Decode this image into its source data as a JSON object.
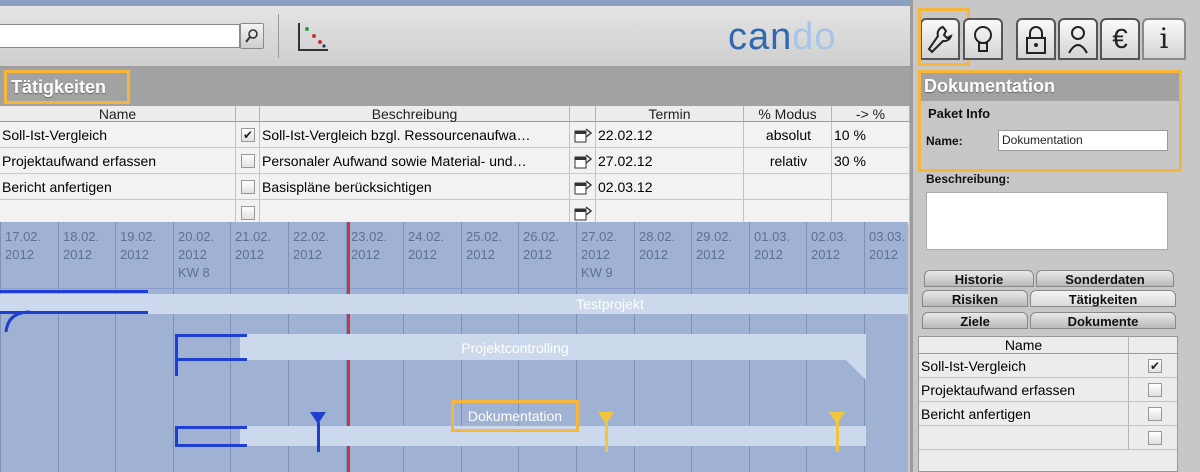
{
  "toolbar": {
    "search_value": "",
    "search_icon": "magnifier-icon",
    "chart_icon": "scatter-chart-icon",
    "logo_left": "can",
    "logo_right": "do"
  },
  "section": {
    "title": "Tätigkeiten"
  },
  "table": {
    "headers": [
      "Name",
      "Beschreibung",
      "Termin",
      "% Modus",
      "-> %"
    ],
    "rows": [
      {
        "name": "Soll-Ist-Vergleich",
        "checked": "✔",
        "desc": "Soll-Ist-Vergleich bzgl. Ressourcenaufwa…",
        "termin": "22.02.12",
        "modus": "absolut",
        "pct": "10 %"
      },
      {
        "name": "Projektaufwand erfassen",
        "checked": "",
        "desc": "Personaler Aufwand sowie Material- und…",
        "termin": "27.02.12",
        "modus": "relativ",
        "pct": "30 %"
      },
      {
        "name": "Bericht anfertigen",
        "checked": "",
        "desc": "Basispläne berücksichtigen",
        "termin": "02.03.12",
        "modus": "",
        "pct": ""
      },
      {
        "name": "",
        "checked": "",
        "desc": "",
        "termin": "",
        "modus": "",
        "pct": ""
      }
    ]
  },
  "gantt": {
    "days": [
      {
        "d": "17.02.",
        "y": "2012",
        "kw": ""
      },
      {
        "d": "18.02.",
        "y": "2012",
        "kw": ""
      },
      {
        "d": "19.02.",
        "y": "2012",
        "kw": ""
      },
      {
        "d": "20.02.",
        "y": "2012",
        "kw": "KW 8"
      },
      {
        "d": "21.02.",
        "y": "2012",
        "kw": ""
      },
      {
        "d": "22.02.",
        "y": "2012",
        "kw": ""
      },
      {
        "d": "23.02.",
        "y": "2012",
        "kw": ""
      },
      {
        "d": "24.02.",
        "y": "2012",
        "kw": ""
      },
      {
        "d": "25.02.",
        "y": "2012",
        "kw": ""
      },
      {
        "d": "26.02.",
        "y": "2012",
        "kw": ""
      },
      {
        "d": "27.02.",
        "y": "2012",
        "kw": "KW 9"
      },
      {
        "d": "28.02.",
        "y": "2012",
        "kw": ""
      },
      {
        "d": "29.02.",
        "y": "2012",
        "kw": ""
      },
      {
        "d": "01.03.",
        "y": "2012",
        "kw": ""
      },
      {
        "d": "02.03.",
        "y": "2012",
        "kw": ""
      },
      {
        "d": "03.03.",
        "y": "2012",
        "kw": ""
      }
    ],
    "bars": {
      "testprojekt": "Testprojekt",
      "projektcontrolling": "Projektcontrolling",
      "dokumentation": "Dokumentation"
    }
  },
  "right": {
    "tab_icons": [
      "wrench-icon",
      "lightbulb-icon",
      "lock-icon",
      "person-icon",
      "euro-icon",
      "info-icon"
    ],
    "title": "Dokumentation",
    "paket_info": "Paket Info",
    "name_label": "Name:",
    "name_value": "Dokumentation",
    "beschreibung_label": "Beschreibung:",
    "tabs_row1": [
      "Historie",
      "Sonderdaten"
    ],
    "tabs_row2": [
      "Risiken",
      "Tätigkeiten"
    ],
    "tabs_row3": [
      "Ziele",
      "Dokumente"
    ],
    "list_header": "Name",
    "list": [
      {
        "name": "Soll-Ist-Vergleich",
        "checked": "✔"
      },
      {
        "name": "Projektaufwand erfassen",
        "checked": ""
      },
      {
        "name": "Bericht anfertigen",
        "checked": ""
      },
      {
        "name": "",
        "checked": ""
      }
    ]
  }
}
